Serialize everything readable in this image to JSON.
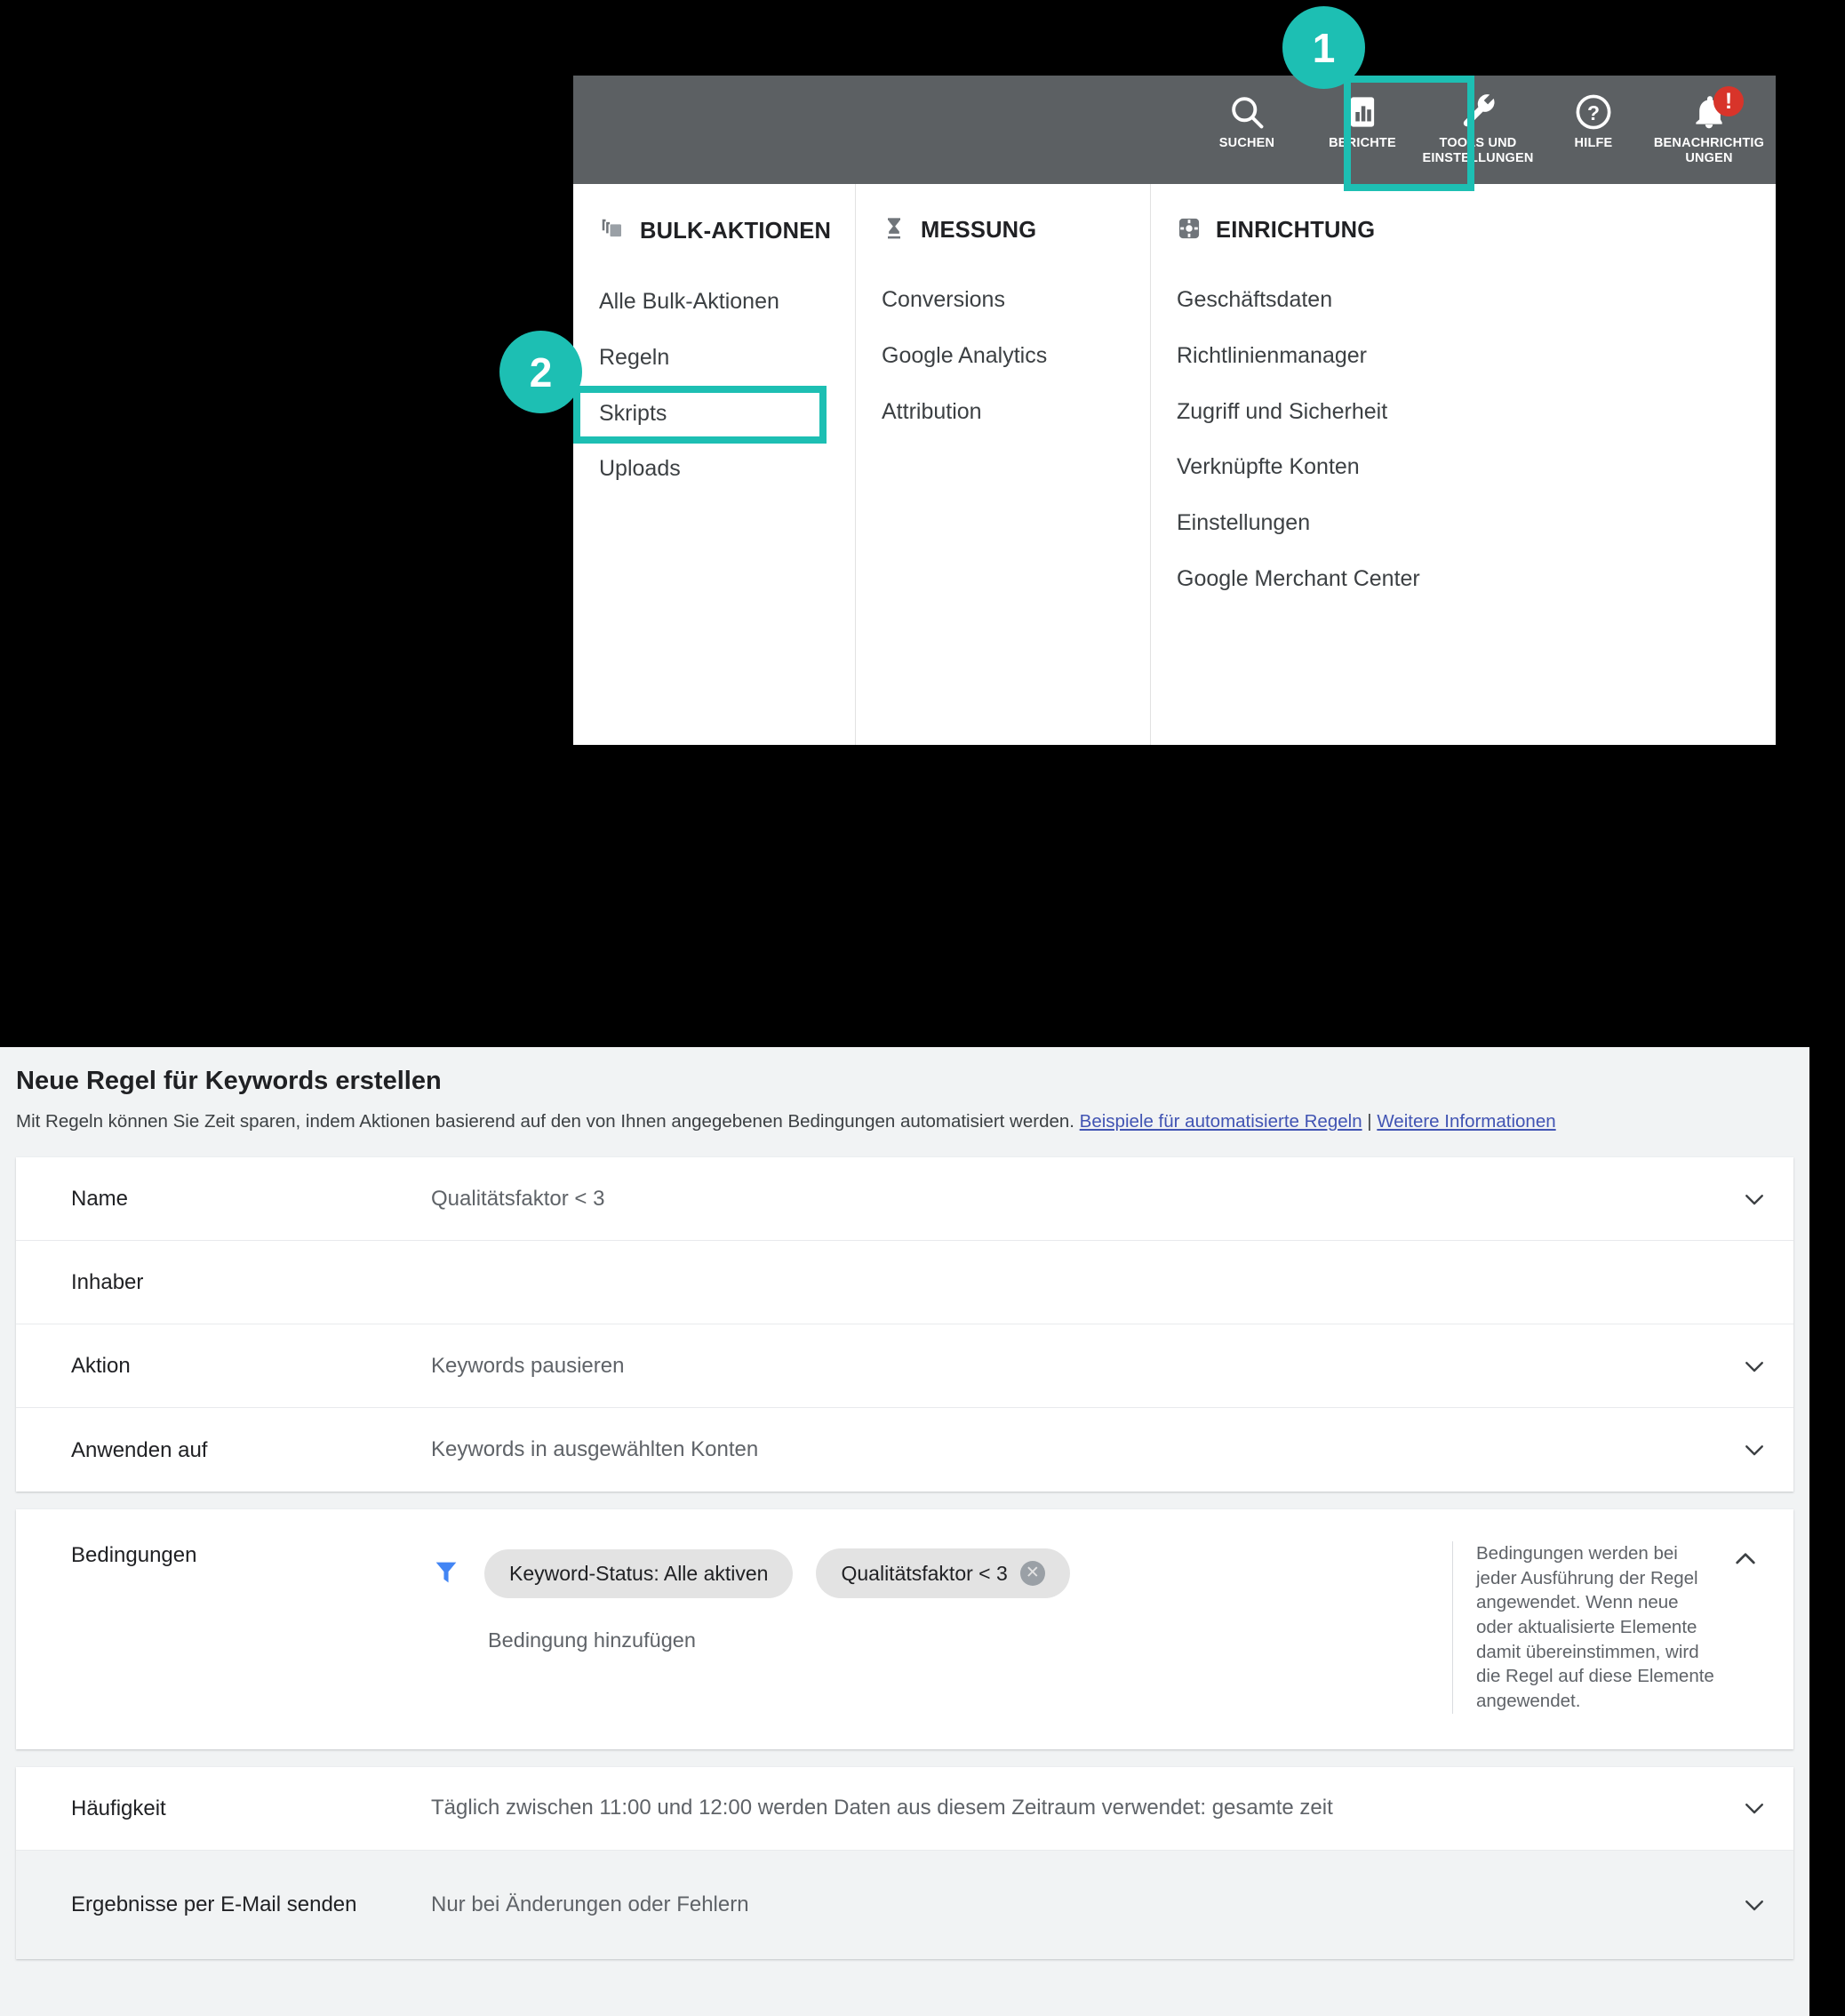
{
  "colors": {
    "accent_teal": "#1dbfb3",
    "toolbar_gray": "#5c6063",
    "alert_red": "#d8342a",
    "link_blue": "#4154b3",
    "chip_gray": "#e3e3e3"
  },
  "steps": [
    {
      "number": "1"
    },
    {
      "number": "2"
    }
  ],
  "toolbar": {
    "items": [
      {
        "icon": "search-icon",
        "label": "SUCHEN"
      },
      {
        "icon": "reports-bar-chart-icon",
        "label": "BERICHTE"
      },
      {
        "icon": "wrench-tools-icon",
        "label": "TOOLS UND EINSTELLUNGEN"
      },
      {
        "icon": "help-question-icon",
        "label": "HILFE"
      },
      {
        "icon": "notifications-bell-icon",
        "label": "BENACHRICHTIG UNGEN",
        "alert": "!"
      }
    ]
  },
  "menu": {
    "columns": [
      {
        "icon": "bulk-actions-copies-icon",
        "title": "BULK-AKTIONEN",
        "links": [
          "Alle Bulk-Aktionen",
          "Regeln",
          "Skripts",
          "Uploads"
        ]
      },
      {
        "icon": "measurement-hourglass-icon",
        "title": "MESSUNG",
        "links": [
          "Conversions",
          "Google Analytics",
          "Attribution"
        ]
      },
      {
        "icon": "setup-gear-icon",
        "title": "EINRICHTUNG",
        "links": [
          "Geschäftsdaten",
          "Richtlinienmanager",
          "Zugriff und Sicherheit",
          "Verknüpfte Konten",
          "Einstellungen",
          "Google Merchant Center"
        ]
      }
    ]
  },
  "rule_form": {
    "title": "Neue Regel für Keywords erstellen",
    "description": "Mit Regeln können Sie Zeit sparen, indem Aktionen basierend auf den von Ihnen angegebenen Bedingungen automatisiert werden.",
    "link_examples": "Beispiele für automatisierte Regeln",
    "separator": "|",
    "link_more": "Weitere Informationen",
    "rows": [
      {
        "label": "Name",
        "value": "Qualitätsfaktor < 3",
        "chevron": "chevron-down-icon"
      },
      {
        "label": "Inhaber",
        "value": "",
        "chevron": ""
      },
      {
        "label": "Aktion",
        "value": "Keywords pausieren",
        "chevron": "chevron-down-icon"
      },
      {
        "label": "Anwenden auf",
        "value": "Keywords in ausgewählten Konten",
        "chevron": "chevron-down-icon"
      }
    ],
    "conditions": {
      "label": "Bedingungen",
      "filter_icon": "filter-funnel-icon",
      "chips": [
        {
          "text": "Keyword-Status: Alle aktiven",
          "removable": false
        },
        {
          "text": "Qualitätsfaktor < 3",
          "removable": true,
          "remove_icon": "chip-remove-icon"
        }
      ],
      "add_label": "Bedingung hinzufügen",
      "help_text": "Bedingungen werden bei jeder Ausführung der Regel angewendet. Wenn neue oder aktualisierte Elemente damit übereinstimmen, wird die Regel auf diese Elemente angewendet.",
      "chevron": "chevron-up-icon"
    },
    "footer_rows": [
      {
        "label": "Häufigkeit",
        "value": "Täglich zwischen 11:00 und 12:00 werden Daten aus diesem Zeitraum verwendet: gesamte zeit",
        "chevron": "chevron-down-icon"
      },
      {
        "label": "Ergebnisse per E-Mail senden",
        "value": "Nur bei Änderungen oder Fehlern",
        "chevron": "chevron-down-icon"
      }
    ]
  }
}
